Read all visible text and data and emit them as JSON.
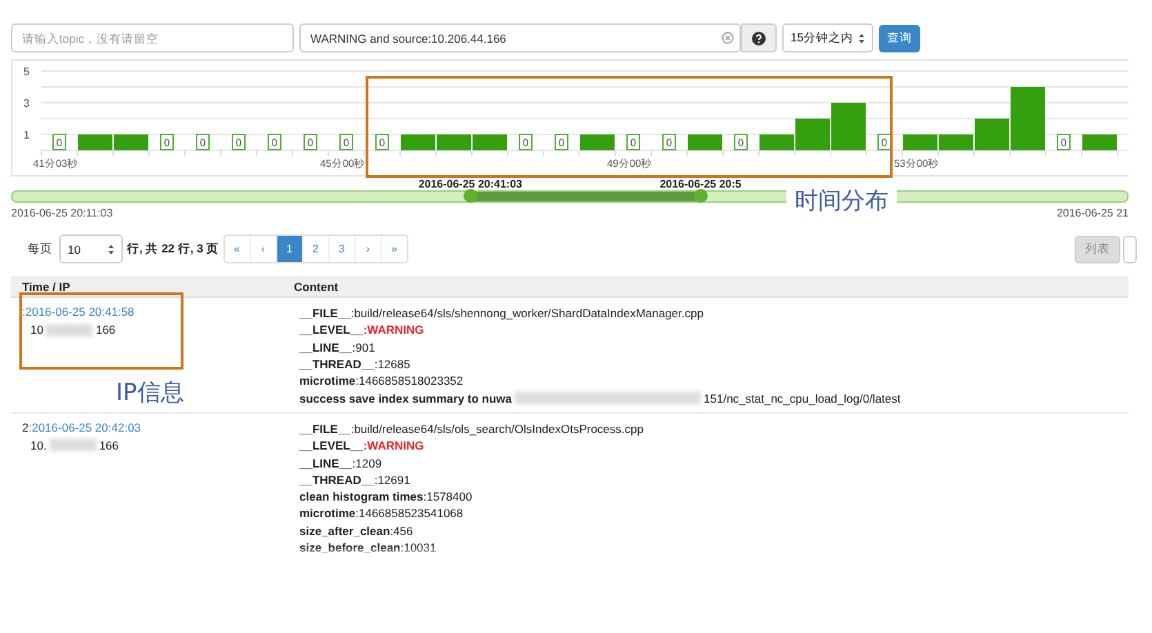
{
  "search_bar": {
    "topic_placeholder": "请输入topic，没有请留空",
    "query": "WARNING and source:10.206.44.166",
    "time_range": "15分钟之内",
    "submit": "查询"
  },
  "histogram": {
    "chart_data": {
      "type": "bar",
      "categories": [
        "41分03秒",
        null,
        null,
        null,
        null,
        null,
        null,
        null,
        "45分00秒",
        null,
        null,
        null,
        null,
        null,
        null,
        null,
        "49分00秒",
        null,
        null,
        null,
        null,
        null,
        null,
        null,
        "53分00秒",
        null,
        null,
        null,
        null,
        null,
        null
      ],
      "values": [
        0,
        1,
        1,
        0,
        0,
        0,
        0,
        0,
        0,
        0,
        1,
        1,
        1,
        0,
        0,
        1,
        0,
        0,
        1,
        0,
        1,
        2,
        3,
        0,
        1,
        1,
        2,
        4,
        0,
        1,
        0
      ],
      "value_labels": [
        "0",
        null,
        null,
        "0",
        "0",
        "0",
        "0",
        "0",
        "0",
        "0",
        null,
        null,
        null,
        "0",
        "0",
        null,
        "0",
        "0",
        null,
        "0",
        null,
        null,
        null,
        "0",
        null,
        null,
        null,
        null,
        "0",
        null,
        null
      ],
      "ylim": [
        0,
        5
      ],
      "yticks": [
        1,
        3,
        5
      ]
    }
  },
  "time_slider": {
    "handles": [
      {
        "label": "2016-06-25 20:41:03",
        "level": 0.411
      },
      {
        "label": "2016-06-25 20:5",
        "level": 0.617
      }
    ],
    "start": "2016-06-25 20:11:03",
    "end": "2016-06-25 21"
  },
  "pager": {
    "per_page_label": "每页",
    "per_page": "10",
    "summary": "行, 共 22 行, 3 页",
    "pages": [
      {
        "label": "«",
        "selected": false
      },
      {
        "label": "‹",
        "selected": false
      },
      {
        "label": "1",
        "selected": true
      },
      {
        "label": "2",
        "selected": false
      },
      {
        "label": "3",
        "selected": false
      },
      {
        "label": "›",
        "selected": false
      },
      {
        "label": "»",
        "selected": false
      }
    ],
    "view_button": "列表"
  },
  "table": {
    "columns": [
      "Time / IP",
      "Content"
    ],
    "rows": [
      {
        "index": "",
        "time": ":2016-06-25 20:41:58",
        "ip_start": "10",
        "ip_end": "166",
        "fields": [
          {
            "kind": "plain",
            "key": "__FILE__",
            "value": ":build/release64/sls/shennong_worker/ShardDataIndexManager.cpp"
          },
          {
            "kind": "warning",
            "key": "__LEVEL__",
            "value": ":WARNING"
          },
          {
            "kind": "plain",
            "key": "__LINE__",
            "value": ":901"
          },
          {
            "kind": "plain",
            "key": "__THREAD__",
            "value": ":12685"
          },
          {
            "kind": "plain",
            "key": "microtime",
            "value": ":1466858518023352"
          },
          {
            "kind": "redacted",
            "key": "success save index summary to nuwa",
            "value": "151/nc_stat_nc_cpu_load_log/0/latest"
          }
        ]
      },
      {
        "index": "2",
        "time": ":2016-06-25 20:42:03",
        "ip_start": "10.",
        "ip_end": "166",
        "fields": [
          {
            "kind": "plain",
            "key": "__FILE__",
            "value": ":build/release64/sls/ols_search/OlsIndexOtsProcess.cpp"
          },
          {
            "kind": "warning",
            "key": "__LEVEL__",
            "value": ":WARNING"
          },
          {
            "kind": "plain",
            "key": "__LINE__",
            "value": ":1209"
          },
          {
            "kind": "plain",
            "key": "__THREAD__",
            "value": ":12691"
          },
          {
            "kind": "plain",
            "key": "clean histogram times",
            "value": ":1578400"
          },
          {
            "kind": "plain",
            "key": "microtime",
            "value": ":1466858523541068"
          },
          {
            "kind": "plain",
            "key": "size_after_clean",
            "value": ":456"
          },
          {
            "kind": "plain",
            "key": "size_before_clean",
            "value": ":10031"
          }
        ]
      }
    ]
  },
  "annotations": [
    {
      "kind": "frame"
    },
    {
      "kind": "label",
      "text": "时间分布"
    },
    {
      "kind": "frame"
    },
    {
      "kind": "label",
      "text": "IP信息"
    }
  ]
}
